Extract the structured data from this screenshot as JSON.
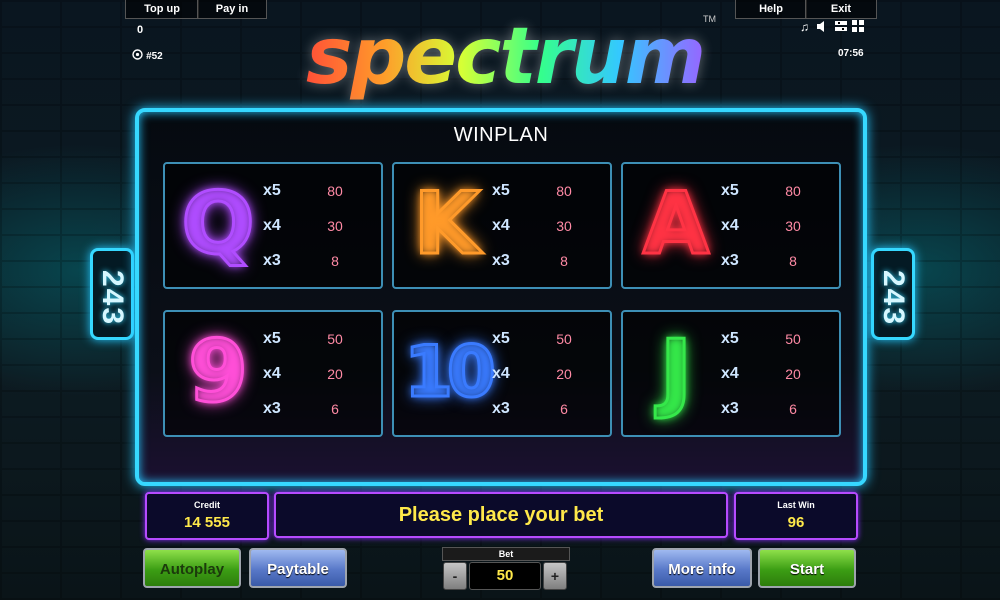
{
  "topbar": {
    "top_up_label": "Top up",
    "pay_in_label": "Pay in",
    "help_label": "Help",
    "exit_label": "Exit",
    "balance_counter": "0",
    "session_id": "#52",
    "clock": "07:56",
    "icons": [
      "music-icon",
      "sound-icon",
      "settings-icon",
      "fullscreen-icon"
    ]
  },
  "logo": {
    "text": "spectrum",
    "trademark": "TM"
  },
  "winplan": {
    "title": "WINPLAN",
    "symbols": [
      {
        "symbol": "Q",
        "color": "#b04dff",
        "rows": [
          {
            "mult": "x5",
            "pay": "80"
          },
          {
            "mult": "x4",
            "pay": "30"
          },
          {
            "mult": "x3",
            "pay": "8"
          }
        ]
      },
      {
        "symbol": "K",
        "color": "#ff9a2a",
        "rows": [
          {
            "mult": "x5",
            "pay": "80"
          },
          {
            "mult": "x4",
            "pay": "30"
          },
          {
            "mult": "x3",
            "pay": "8"
          }
        ]
      },
      {
        "symbol": "A",
        "color": "#ff3344",
        "rows": [
          {
            "mult": "x5",
            "pay": "80"
          },
          {
            "mult": "x4",
            "pay": "30"
          },
          {
            "mult": "x3",
            "pay": "8"
          }
        ]
      },
      {
        "symbol": "9",
        "color": "#ff4fd8",
        "rows": [
          {
            "mult": "x5",
            "pay": "50"
          },
          {
            "mult": "x4",
            "pay": "20"
          },
          {
            "mult": "x3",
            "pay": "6"
          }
        ]
      },
      {
        "symbol": "10",
        "color": "#3a7bff",
        "rows": [
          {
            "mult": "x5",
            "pay": "50"
          },
          {
            "mult": "x4",
            "pay": "20"
          },
          {
            "mult": "x3",
            "pay": "6"
          }
        ]
      },
      {
        "symbol": "J",
        "color": "#35e84a",
        "rows": [
          {
            "mult": "x5",
            "pay": "50"
          },
          {
            "mult": "x4",
            "pay": "20"
          },
          {
            "mult": "x3",
            "pay": "6"
          }
        ]
      }
    ]
  },
  "ways": {
    "left": "243",
    "right": "243"
  },
  "status": {
    "credit_label": "Credit",
    "credit_value": "14 555",
    "message": "Please place your bet",
    "last_win_label": "Last Win",
    "last_win_value": "96"
  },
  "controls": {
    "autoplay_label": "Autoplay",
    "paytable_label": "Paytable",
    "bet_label": "Bet",
    "bet_value": "50",
    "minus_label": "-",
    "plus_label": "+",
    "more_info_label": "More info",
    "start_label": "Start"
  }
}
